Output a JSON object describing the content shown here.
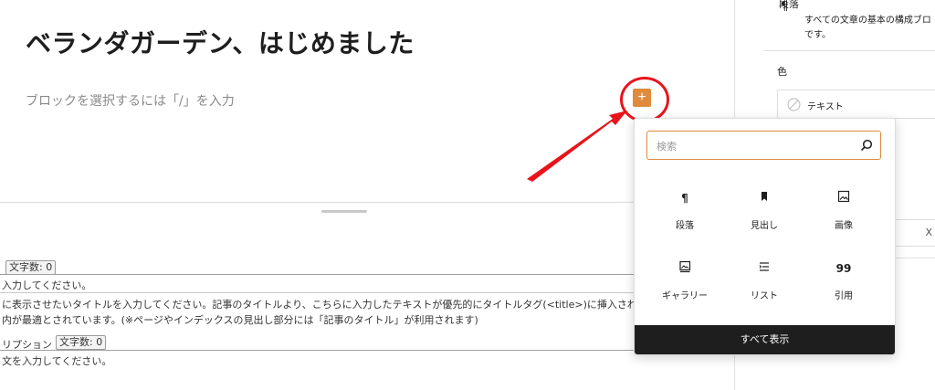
{
  "editor": {
    "post_title": "ベランダガーデン、はじめました",
    "block_placeholder": "ブロックを選択するには「/」を入力",
    "inserter_symbol": "+"
  },
  "meta_box": {
    "char_count_badge_1": "文字数: 0",
    "title_input_hint": "入力してください。",
    "title_description_1": "に表示させたいタイトルを入力してください。記事のタイトルより、こちらに入力したテキストが優先的にタイトルタグ(<title>)に挿入されます。",
    "title_description_2": "内が最適とされています。(※ページやインデックスの見出し部分には「記事のタイトル」が利用されます)",
    "description_label": "リプション",
    "char_count_badge_2": "文字数: 0",
    "description_input_hint": "文を入力してください。"
  },
  "sidebar": {
    "block_name": "段落",
    "block_description_1": "すべての文章の基本の構成ブロ",
    "block_description_2": "です。",
    "color_heading": "色",
    "text_color_label": "テキスト",
    "close_symbol": "X"
  },
  "inserter_popover": {
    "search_placeholder": "検索",
    "blocks": [
      {
        "label": "段落",
        "icon": "paragraph-icon",
        "glyph": "¶"
      },
      {
        "label": "見出し",
        "icon": "bookmark-icon",
        "glyph": ""
      },
      {
        "label": "画像",
        "icon": "image-icon",
        "glyph": ""
      },
      {
        "label": "ギャラリー",
        "icon": "gallery-icon",
        "glyph": ""
      },
      {
        "label": "リスト",
        "icon": "list-icon",
        "glyph": ""
      },
      {
        "label": "引用",
        "icon": "quote-icon",
        "glyph": "99"
      }
    ],
    "show_all_label": "すべて表示"
  },
  "colors": {
    "accent": "#e08a3c",
    "annotation_red": "#e8141c",
    "dark": "#1e1e1e"
  }
}
